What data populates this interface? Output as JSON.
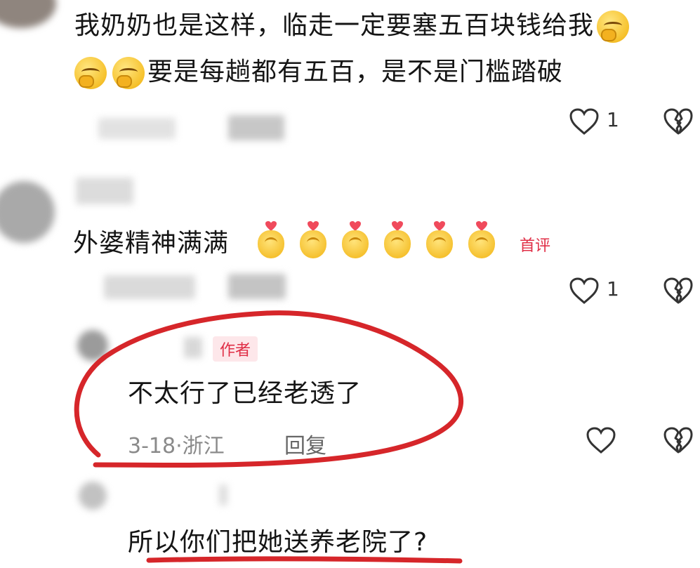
{
  "comments": [
    {
      "text_line1": "我奶奶也是这样，临走一定要塞五百块钱给我",
      "text_line2": "要是每趟都有五百，是不是门槛踏破",
      "likes": "1"
    },
    {
      "text": "外婆精神满满",
      "badge": "首评",
      "likes": "1"
    },
    {
      "author_tag": "作者",
      "text": "不太行了已经老透了",
      "date": "3-18",
      "location": "浙江",
      "separator": "·",
      "reply": "回复"
    },
    {
      "text": "所以你们把她送养老院了?"
    }
  ],
  "icons": {
    "like": "heart-outline-icon",
    "dislike": "broken-heart-icon",
    "emoji_smile": "covering-mouth-smile-emoji",
    "emoji_finger_heart": "finger-heart-emoji"
  },
  "colors": {
    "annotation_red": "#d6262a",
    "author_tag_bg": "#fde7ea",
    "author_tag_text": "#e02e46",
    "meta_gray": "#8a8a8a"
  }
}
